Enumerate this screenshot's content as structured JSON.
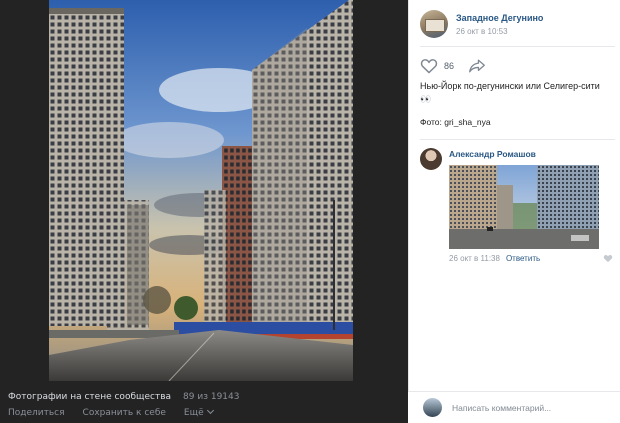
{
  "author": {
    "name": "Западное Дегунино",
    "time": "26 окт в 10:53"
  },
  "likes": {
    "count": "86"
  },
  "post": {
    "caption": "Нью-Йорк по-дегунински или Селигер-сити",
    "caption_emoji": "👀",
    "credit": "Фото: gri_sha_nya"
  },
  "comment": {
    "author": "Александр Ромашов",
    "time": "26 окт в 11:38",
    "reply_label": "Ответить"
  },
  "composer": {
    "placeholder": "Написать комментарий..."
  },
  "footer": {
    "title": "Фотографии на стене сообщества",
    "counter": "89 из 19143",
    "share_label": "Поделиться",
    "save_label": "Сохранить к себе",
    "more_label": "Ещё"
  },
  "icons": {
    "like": "heart-icon",
    "share": "share-arrow-icon",
    "comment_like": "heart-icon"
  },
  "colors": {
    "link": "#2a5885",
    "muted": "#939ba5",
    "viewer_background": "#232323"
  }
}
